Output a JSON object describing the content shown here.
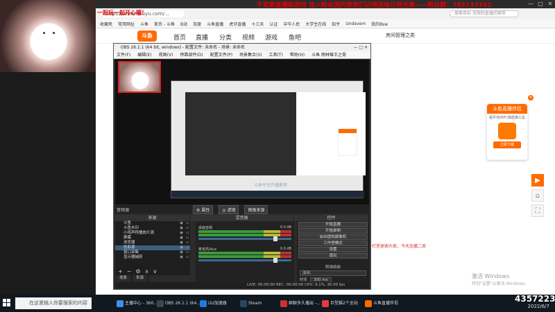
{
  "overlay": {
    "marquee_top": "不定期直播新游戏 加入粉丝团的铁铁们记得送每日荧光棒——粉丝群：785133762",
    "marquee_left": "一起玩一起开心哦！"
  },
  "browser": {
    "address": "https://www.douyu.com/...",
    "search_placeholder": "搜索目标 无限制直播间推荐",
    "bookmarks": [
      "收藏夹",
      "常用网址",
      "斗鱼",
      "首页 - 斗鱼",
      "B站",
      "百度",
      "斗鱼直播",
      "虎牙直播",
      "十三天",
      "认证",
      "中华人民",
      "大学生在线",
      "知乎",
      "Undavem",
      "我的Bsw"
    ]
  },
  "douyu": {
    "logo": "斗鱼",
    "nav": [
      "首页",
      "直播",
      "分类",
      "视频",
      "游戏",
      "鱼吧"
    ],
    "user_label": "房间管理之类",
    "side_card": {
      "title": "斗鱼直播伴侣",
      "desc": "超乎你的PC端直播工具",
      "download": "立即下载"
    },
    "side_buttons": [
      "▶",
      "⌂",
      "⛶"
    ]
  },
  "obs": {
    "title": "OBS 26.1.1 (64 bit, windows) - 配置文件: 未命名 - 场景: 未命名",
    "menu": [
      "文件(F)",
      "编辑(E)",
      "视图(V)",
      "停靠部件(D)",
      "配置文件(P)",
      "场景集合(S)",
      "工具(T)",
      "帮助(H)",
      "斗鱼 雨林莓王之骨"
    ],
    "selection_label": "音频源",
    "props_buttons": [
      "⚙ 属性",
      "◎ 滤镜",
      "图像来源"
    ],
    "dock_headers": [
      "来源",
      "混音器",
      "控件"
    ],
    "sources": [
      {
        "name": "斗鱼",
        "selected": false
      },
      {
        "name": "斗鱼水印",
        "selected": false
      },
      {
        "name": "小鸡声称播放片源",
        "selected": false
      },
      {
        "name": "屏幕",
        "selected": false
      },
      {
        "name": "浏览器",
        "selected": false
      },
      {
        "name": "色彩源",
        "selected": true
      },
      {
        "name": "窗口采集",
        "selected": false
      },
      {
        "name": "显示器捕获",
        "selected": false
      }
    ],
    "source_tools": [
      "+",
      "−",
      "⚙",
      "∧",
      "∨"
    ],
    "scene_tabs": [
      "场景",
      "来源"
    ],
    "mixer": [
      {
        "name": "桌面音频",
        "level": "0.0 dB"
      },
      {
        "name": "麦克风/Aux",
        "level": "0.0 dB"
      }
    ],
    "controls": [
      "开始直播",
      "开始录制",
      "启动虚拟摄像机",
      "工作室模式",
      "设置",
      "退出"
    ],
    "transition_header": "转场特效",
    "transition_value": "淡出",
    "duration_label": "时长",
    "duration_value": "300 ms",
    "status": "LIVE: 00:00:00   REC: 00:00:00   CPU: 9.1%, 30.00 fps",
    "nested_label": "斗鱼平台开播推荐",
    "bottom_red_text": "打赏谢谢大家，今天加播二周"
  },
  "watermark": {
    "line1": "激活 Windows",
    "line2": "转到\"设置\"以激活 Windows。"
  },
  "viewer_count": "4357223",
  "taskbar": {
    "search_placeholder": "在这里输入你要搜索的内容",
    "tasks": [
      {
        "label": "主播中心 - 360...",
        "color": "#3c8ff0"
      },
      {
        "label": "OBS 26.1.1 (64...",
        "color": "#444"
      },
      {
        "label": "UU加速器",
        "color": "#1f7ae0"
      },
      {
        "label": "Steam",
        "color": "#2a475e"
      },
      {
        "label": "群聊多久播出 -...",
        "color": "#d03030"
      },
      {
        "label": "巨型猫2个全站",
        "color": "#e63a3a"
      },
      {
        "label": "斗鱼直播伴侣",
        "color": "#ff6a00"
      }
    ],
    "clock": "2022/6/7"
  },
  "colors": {
    "accent": "#ff6a00",
    "marquee": "#e00000",
    "obs_bg": "#2b2b2b"
  }
}
